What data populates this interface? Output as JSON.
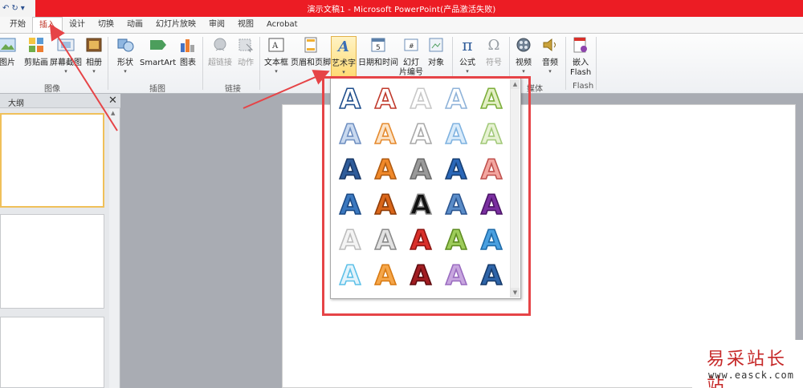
{
  "window": {
    "title": "演示文稿1  -  Microsoft PowerPoint(产品激活失败)"
  },
  "tabs": [
    "开始",
    "插入",
    "设计",
    "切换",
    "动画",
    "幻灯片放映",
    "审阅",
    "视图",
    "Acrobat"
  ],
  "active_tab": "插入",
  "ribbon": {
    "buttons": {
      "picture": "图片",
      "clipart": "剪贴画",
      "screenshot": "屏幕截图",
      "album": "相册",
      "shapes": "形状",
      "smartart": "SmartArt",
      "chart": "图表",
      "hyperlink": "超链接",
      "action": "动作",
      "textbox": "文本框",
      "header_footer": "页眉和页脚",
      "wordart": "艺术字",
      "datetime": "日期和时间",
      "slide_number": "幻灯\n片编号",
      "object": "对象",
      "equation": "公式",
      "symbol": "符号",
      "video": "视频",
      "audio": "音频",
      "embed_flash": "嵌入\nFlash"
    },
    "groups": {
      "images": "图像",
      "illustrations": "插图",
      "links": "链接",
      "media": "媒体",
      "flash": "Flash"
    }
  },
  "left_pane": {
    "tab": "大纲",
    "close": "✕"
  },
  "gallery_styles": [
    {
      "fill": "#ffffff",
      "stroke": "#1f4e8c"
    },
    {
      "fill": "#ffffff",
      "stroke": "#c0392b"
    },
    {
      "fill": "#ffffff",
      "stroke": "#c8c8c8"
    },
    {
      "fill": "#ffffff",
      "stroke": "#8fb3d9"
    },
    {
      "fill": "#e3efc5",
      "stroke": "#7cae3a"
    },
    {
      "fill": "#c9d9ef",
      "stroke": "#6f8fc1"
    },
    {
      "fill": "#fbe3c7",
      "stroke": "#e58a2e"
    },
    {
      "fill": "#ffffff",
      "stroke": "#a9a9a9"
    },
    {
      "fill": "#d9ebfa",
      "stroke": "#7fb2e0"
    },
    {
      "fill": "#e7f2d3",
      "stroke": "#a2c97a"
    },
    {
      "fill": "#2f5c9a",
      "stroke": "#1a3866"
    },
    {
      "fill": "#f0892a",
      "stroke": "#b05a10"
    },
    {
      "fill": "#9a9a9a",
      "stroke": "#6a6a6a"
    },
    {
      "fill": "#2a67b8",
      "stroke": "#173f73"
    },
    {
      "fill": "#f3a6a0",
      "stroke": "#c0504d"
    },
    {
      "fill": "#3b78bf",
      "stroke": "#1b4a85"
    },
    {
      "fill": "#d9661a",
      "stroke": "#8f3c07"
    },
    {
      "fill": "#111111",
      "stroke": "#888888"
    },
    {
      "fill": "#5a8cc8",
      "stroke": "#2b5590"
    },
    {
      "fill": "#7a2fa0",
      "stroke": "#4a1466"
    },
    {
      "fill": "#f4f4f4",
      "stroke": "#bdbdbd"
    },
    {
      "fill": "#e2e2e2",
      "stroke": "#8a8a8a"
    },
    {
      "fill": "#d9302a",
      "stroke": "#8c1410"
    },
    {
      "fill": "#9dcc5a",
      "stroke": "#5e8c22"
    },
    {
      "fill": "#4aa0e0",
      "stroke": "#1d6aa8"
    },
    {
      "fill": "#e3f3fb",
      "stroke": "#5ec1e8"
    },
    {
      "fill": "#f5a64a",
      "stroke": "#d87a12"
    },
    {
      "fill": "#a11d22",
      "stroke": "#5e0b0e"
    },
    {
      "fill": "#c8a6df",
      "stroke": "#9a6cc0"
    },
    {
      "fill": "#2e64a8",
      "stroke": "#163a6a"
    }
  ],
  "watermark": {
    "line1": "易采站长站",
    "line2": "www.easck.com"
  },
  "colors": {
    "title_bar": "#ec1c24",
    "annotation_red": "#e64447"
  }
}
